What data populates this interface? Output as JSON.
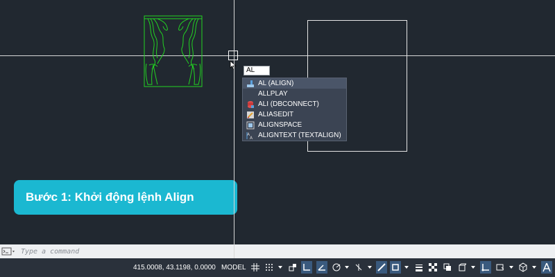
{
  "command_input": {
    "value": "AL"
  },
  "suggestions": [
    {
      "label": "AL (ALIGN)",
      "icon": "align-icon",
      "selected": true
    },
    {
      "label": "ALLPLAY",
      "icon": "",
      "selected": false
    },
    {
      "label": "ALI (DBCONNECT)",
      "icon": "dbconnect-icon",
      "selected": false
    },
    {
      "label": "ALIASEDIT",
      "icon": "aliasedit-icon",
      "selected": false
    },
    {
      "label": "ALIGNSPACE",
      "icon": "alignspace-icon",
      "selected": false
    },
    {
      "label": "ALIGNTEXT (TEXTALIGN)",
      "icon": "textalign-icon",
      "selected": false
    }
  ],
  "banner": {
    "text": "Bước 1: Khởi động lệnh Align"
  },
  "command_line": {
    "placeholder": "Type a command"
  },
  "status_bar": {
    "coordinates": "415.0008, 43.1198, 0.0000",
    "model_label": "MODEL"
  },
  "colors": {
    "canvas": "#212830",
    "banner": "#1bb8d1",
    "curtain": "#22d322",
    "status_bar": "#2a313b"
  }
}
